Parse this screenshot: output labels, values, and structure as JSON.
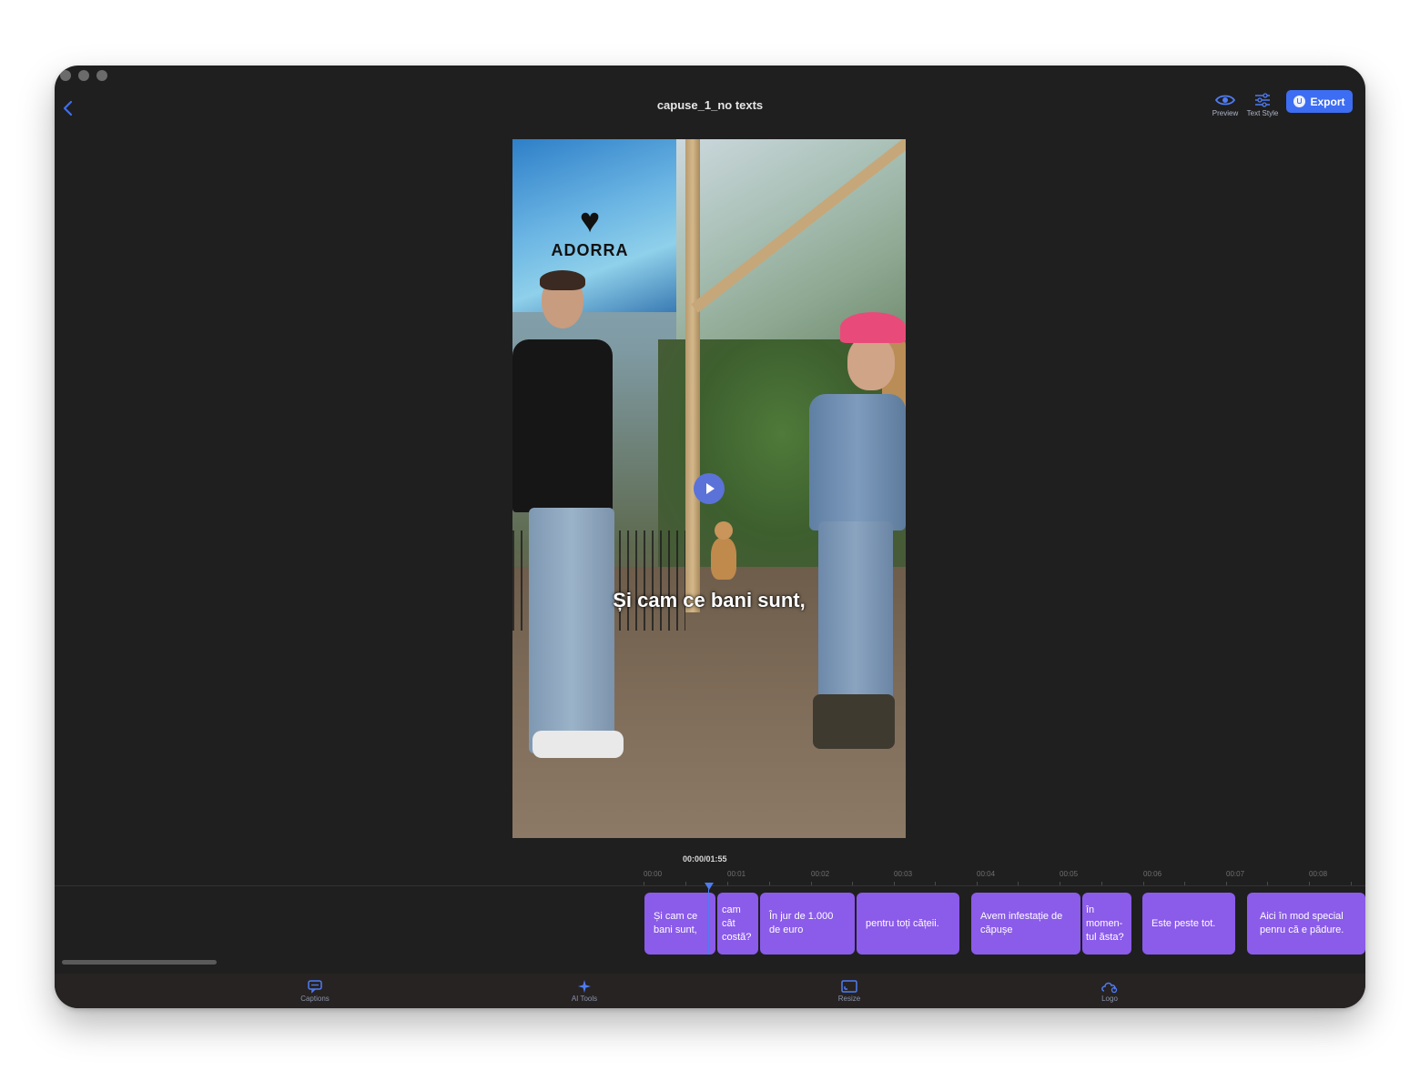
{
  "window": {
    "title": "capuse_1_no texts"
  },
  "toolbar": {
    "preview_label": "Preview",
    "text_style_label": "Text Style",
    "export_label": "Export"
  },
  "video": {
    "logo_text": "ADORRA",
    "current_subtitle": "Și cam ce bani sunt,"
  },
  "timeline": {
    "timecode": "00:00/01:55",
    "ticks": [
      "00:00",
      "00:01",
      "00:02",
      "00:03",
      "00:04",
      "00:05",
      "00:06",
      "00:07",
      "00:08"
    ],
    "clips": [
      "Și cam ce bani sunt,",
      "cam cât costă?",
      "În jur de 1.000 de euro",
      "pentru toți cățeii.",
      "Avem infestație de căpușe",
      "în momen- tul ăsta?",
      "Este peste tot.",
      "Aici în mod special penru că e pădure."
    ]
  },
  "bottom_tabs": {
    "captions": "Captions",
    "ai_tools": "AI Tools",
    "resize": "Resize",
    "logo": "Logo"
  },
  "colors": {
    "accent": "#3d6df2",
    "clip": "#8b5be9",
    "background": "#1f1f1f"
  }
}
